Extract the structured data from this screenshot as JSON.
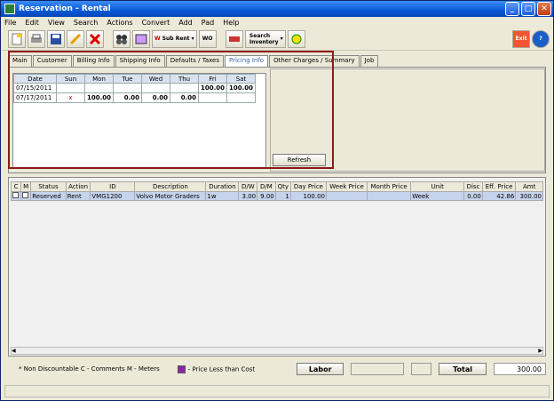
{
  "window": {
    "title": "Reservation - Rental"
  },
  "menu": [
    "File",
    "Edit",
    "View",
    "Search",
    "Actions",
    "Convert",
    "Add",
    "Pad",
    "Help"
  ],
  "toolbar": {
    "sub_rent": "Sub Rent",
    "wo": "WO",
    "search_inventory": "Search Inventory"
  },
  "tabs": [
    "Main",
    "Customer",
    "Billing Info",
    "Shipping Info",
    "Defaults / Taxes",
    "Pricing Info",
    "Other Charges / Summary",
    "Job"
  ],
  "active_tab": "Pricing Info",
  "pricing": {
    "headers": [
      "Date",
      "Sun",
      "Mon",
      "Tue",
      "Wed",
      "Thu",
      "Fri",
      "Sat"
    ],
    "rows": [
      [
        "07/15/2011",
        "",
        "",
        "",
        "",
        "",
        "100.00",
        "100.00"
      ],
      [
        "07/17/2011",
        "x",
        "100.00",
        "0.00",
        "0.00",
        "0.00",
        "",
        ""
      ]
    ],
    "refresh_label": "Refresh"
  },
  "lines": {
    "headers": [
      "C",
      "M",
      "Status",
      "Action",
      "ID",
      "Description",
      "Duration",
      "D/W",
      "D/M",
      "Qty",
      "Day Price",
      "Week Price",
      "Month Price",
      "Unit",
      "Disc",
      "Eff. Price",
      "Amt"
    ],
    "rows": [
      [
        "",
        "",
        "Reserved",
        "Rent",
        "VMG1200",
        "Volvo Motor Graders",
        "1w",
        "3.00",
        "9.00",
        "1",
        "100.00",
        "",
        "",
        "Week",
        "0.00",
        "42.86",
        "300.00"
      ]
    ]
  },
  "status": {
    "legend_text": "* Non Discountable   C - Comments   M - Meters",
    "price_less_text": "- Price Less than Cost",
    "labor_label": "Labor",
    "total_label": "Total",
    "total_value": "300.00"
  }
}
